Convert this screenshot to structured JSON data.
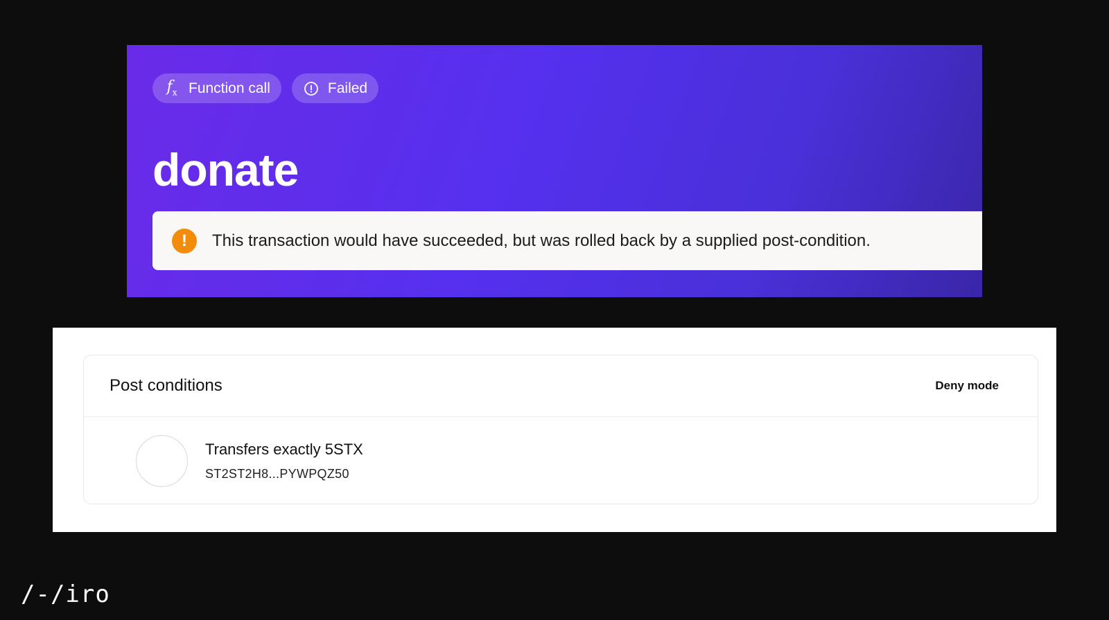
{
  "hero": {
    "badges": [
      {
        "icon": "function-icon",
        "label": "Function call"
      },
      {
        "icon": "alert-circle-icon",
        "label": "Failed"
      }
    ],
    "title": "donate",
    "alert": {
      "icon": "warning-icon",
      "icon_glyph": "!",
      "text": "This transaction would have succeeded, but was rolled back by a supplied post-condition."
    }
  },
  "post_conditions": {
    "title": "Post conditions",
    "mode": "Deny mode",
    "items": [
      {
        "title": "Transfers exactly 5STX",
        "address": "ST2ST2H8...PYWPQZ50"
      }
    ]
  },
  "logo": {
    "text": "/-/iro"
  },
  "colors": {
    "hero_gradient_start": "#6a2be8",
    "hero_gradient_end": "#3a26a8",
    "warning": "#f28c0a",
    "background": "#0d0d0d"
  }
}
